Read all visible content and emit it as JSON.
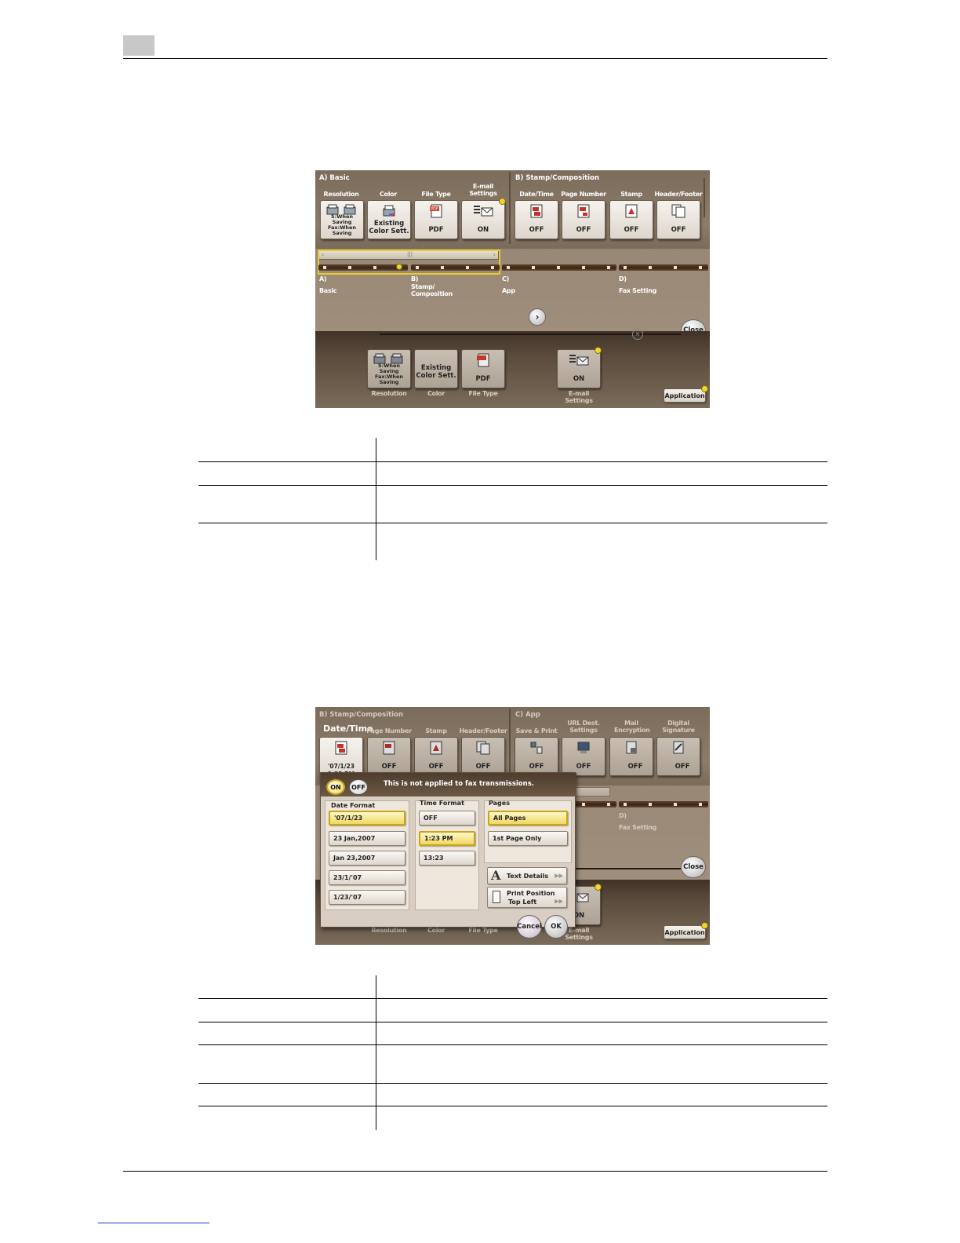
{
  "shot1": {
    "sections": {
      "basic": "A)  Basic",
      "stamp": "B)  Stamp/Composition"
    },
    "functions": [
      {
        "label": "Resolution",
        "value": "S:When Saving Fax:When Saving",
        "icon": "resolution-icon"
      },
      {
        "label": "Color",
        "value": "Existing Color Sett.",
        "icon": "color-icon"
      },
      {
        "label": "File Type",
        "value": "PDF",
        "icon": "pdf-icon"
      },
      {
        "label": "E-mail Settings",
        "value": "ON",
        "icon": "email-icon"
      },
      {
        "label": "Date/Time",
        "value": "OFF",
        "icon": "date-time-icon"
      },
      {
        "label": "Page Number",
        "value": "OFF",
        "icon": "page-number-icon"
      },
      {
        "label": "Stamp",
        "value": "OFF",
        "icon": "stamp-icon"
      },
      {
        "label": "Header/Footer",
        "value": "OFF",
        "icon": "header-footer-icon"
      }
    ],
    "timeline": [
      {
        "letter": "A)",
        "name": "Basic"
      },
      {
        "letter": "B)",
        "name": "Stamp/ Composition"
      },
      {
        "letter": "C)",
        "name": "App"
      },
      {
        "letter": "D)",
        "name": "Fax Setting"
      }
    ],
    "close_label": "Close",
    "application_label": "Application",
    "lower": [
      {
        "label": "Resolution",
        "value": "S:When Saving Fax:When Saving"
      },
      {
        "label": "Color",
        "value": "Existing Color Sett."
      },
      {
        "label": "File Type",
        "value": "PDF"
      },
      {
        "label": "E-mail Settings",
        "value": "ON"
      }
    ]
  },
  "shot2": {
    "sections": {
      "stamp": "B)  Stamp/Composition",
      "app": "C)  App"
    },
    "active_label": "Date/Time",
    "active_value": "'07/1/23 1:23 PM",
    "functions": [
      {
        "label": "Page Number",
        "value": "OFF"
      },
      {
        "label": "Stamp",
        "value": "OFF"
      },
      {
        "label": "Header/Footer",
        "value": "OFF"
      },
      {
        "label": "Save & Print",
        "value": "OFF"
      },
      {
        "label": "URL Dest. Settings",
        "value": "OFF"
      },
      {
        "label": "Mail Encryption",
        "value": "OFF"
      },
      {
        "label": "Digital Signature",
        "value": "OFF"
      }
    ],
    "dialog": {
      "on_label": "ON",
      "off_label": "OFF",
      "message": "This is not applied to fax transmissions.",
      "date_format_title": "Date Format",
      "date_formats": [
        "'07/1/23",
        "23 Jan,2007",
        "Jan 23,2007",
        "23/1/'07",
        "1/23/'07"
      ],
      "time_format_title": "Time Format",
      "time_formats": [
        "OFF",
        "1:23 PM",
        "13:23"
      ],
      "pages_title": "Pages",
      "pages": [
        "All Pages",
        "1st Page Only"
      ],
      "text_details": "Text Details",
      "print_position_line1": "Print Position",
      "print_position_line2": "Top Left",
      "cancel": "Cancel",
      "ok": "OK"
    },
    "timeline_d_letter": "D)",
    "timeline_d_name": "Fax Setting",
    "close_label": "Close",
    "application_label": "Application",
    "lower_email_value": "ON",
    "lower_labels": [
      "Resolution",
      "Color",
      "File Type",
      "E-mail Settings"
    ]
  },
  "colors": {
    "accent_yellow": "#f2d52c",
    "panel_brown": "#8e7e6c"
  }
}
